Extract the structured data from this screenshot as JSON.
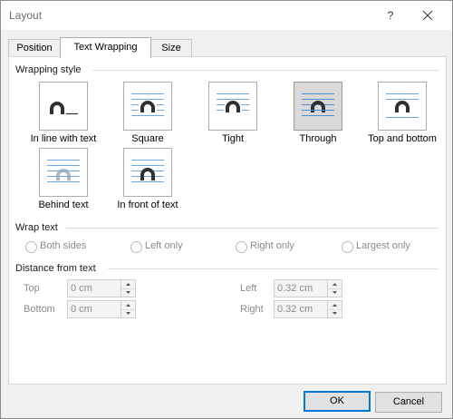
{
  "window": {
    "title": "Layout",
    "help_glyph": "?"
  },
  "tabs": [
    {
      "label": "Position",
      "active": false
    },
    {
      "label": "Text Wrapping",
      "active": true
    },
    {
      "label": "Size",
      "active": false
    }
  ],
  "wrapping_style": {
    "heading": "Wrapping style",
    "selected": "Through",
    "options": [
      {
        "label": "In line with text",
        "icon": "in-line-with-text-icon"
      },
      {
        "label": "Square",
        "icon": "square-wrap-icon"
      },
      {
        "label": "Tight",
        "icon": "tight-wrap-icon"
      },
      {
        "label": "Through",
        "icon": "through-wrap-icon"
      },
      {
        "label": "Top and bottom",
        "icon": "top-and-bottom-wrap-icon"
      },
      {
        "label": "Behind text",
        "icon": "behind-text-icon"
      },
      {
        "label": "In front of text",
        "icon": "in-front-of-text-icon"
      }
    ]
  },
  "wrap_text": {
    "heading": "Wrap text",
    "options": [
      "Both sides",
      "Left only",
      "Right only",
      "Largest only"
    ]
  },
  "distance": {
    "heading": "Distance from text",
    "top": {
      "label": "Top",
      "value": "0 cm"
    },
    "bottom": {
      "label": "Bottom",
      "value": "0 cm"
    },
    "left": {
      "label": "Left",
      "value": "0.32 cm"
    },
    "right": {
      "label": "Right",
      "value": "0.32 cm"
    }
  },
  "buttons": {
    "ok": "OK",
    "cancel": "Cancel"
  },
  "colors": {
    "accent": "#0078d7",
    "line_blue": "#6fa8dc",
    "shape_dark": "#303030"
  }
}
